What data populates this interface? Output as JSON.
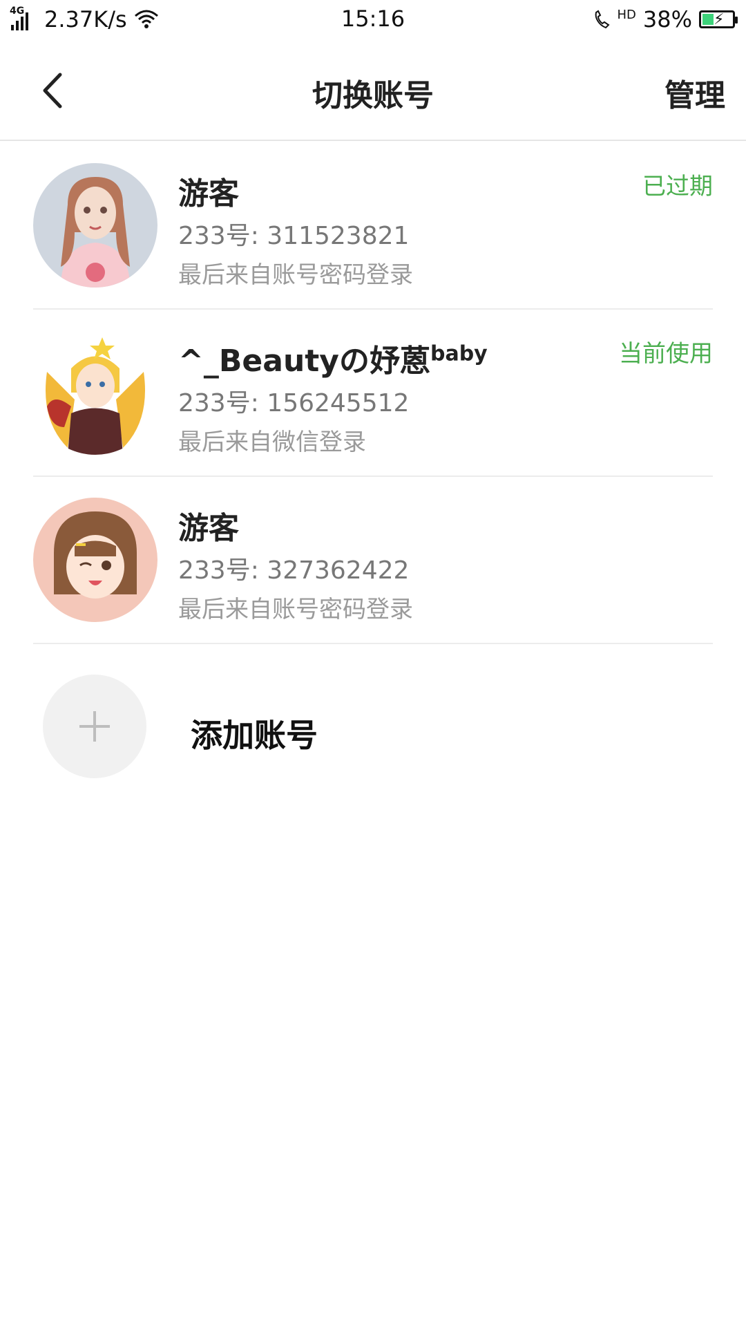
{
  "status_bar": {
    "network_type": "4G",
    "speed": "2.37K/s",
    "time": "15:16",
    "call_hd": "HD",
    "battery_percent": "38%",
    "battery_level": 0.38
  },
  "nav": {
    "title": "切换账号",
    "manage_label": "管理"
  },
  "accounts": [
    {
      "name": "游客",
      "name_sup": "",
      "id_text": "233号: 311523821",
      "login_text": "最后来自账号密码登录",
      "status": "已过期"
    },
    {
      "name": "^_Beautyの妤蒽",
      "name_sup": "baby",
      "id_text": "233号: 156245512",
      "login_text": "最后来自微信登录",
      "status": "当前使用"
    },
    {
      "name": "游客",
      "name_sup": "",
      "id_text": "233号: 327362422",
      "login_text": "最后来自账号密码登录",
      "status": ""
    }
  ],
  "add_account": {
    "label": "添加账号"
  },
  "colors": {
    "status_green": "#4caf50",
    "divider": "#ececec",
    "add_circle_bg": "#f1f1f1"
  }
}
